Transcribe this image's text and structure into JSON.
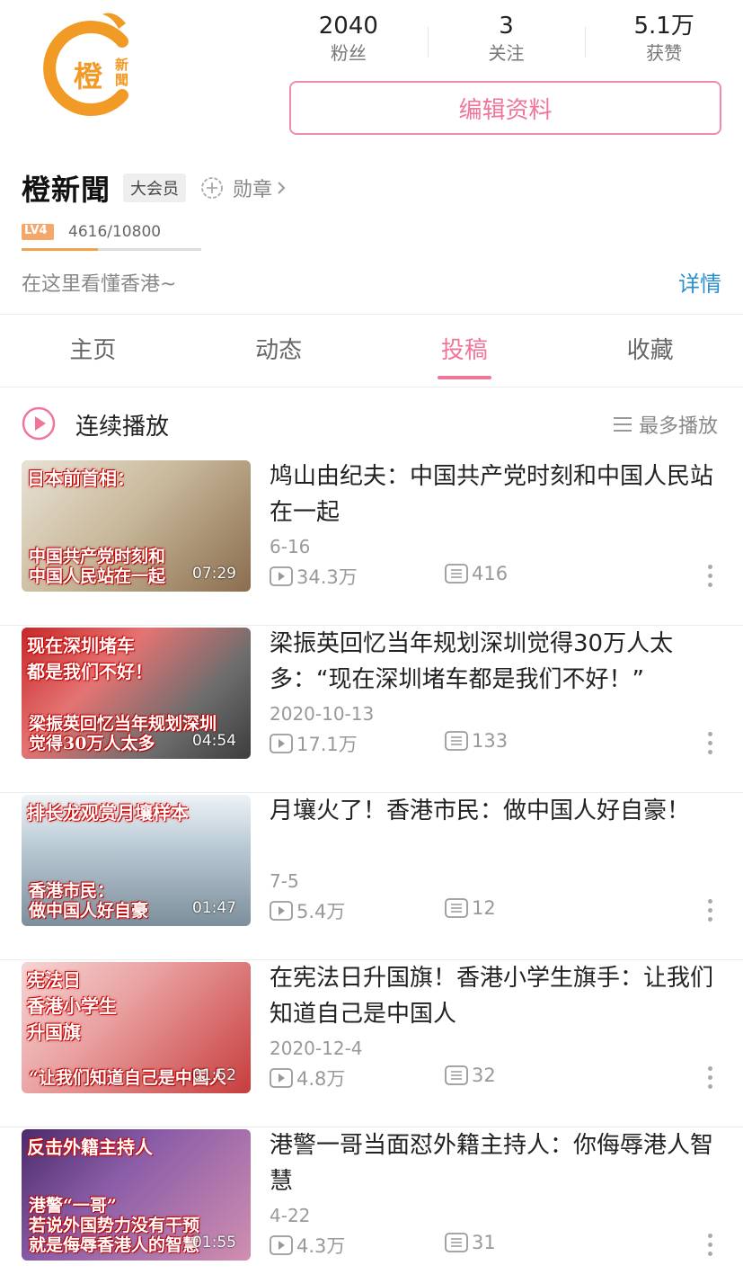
{
  "profile": {
    "logo_text": "橙",
    "logo_sub": "新聞",
    "name": "橙新聞",
    "vip_badge": "大会员",
    "medal_label": "勋章",
    "level_badge": "LV4",
    "exp_text": "4616/10800",
    "exp_fraction": 0.427,
    "signature": "在这里看懂香港~",
    "detail_label": "详情",
    "edit_button": "编辑资料"
  },
  "stats": [
    {
      "value": "2040",
      "label": "粉丝"
    },
    {
      "value": "3",
      "label": "关注"
    },
    {
      "value": "5.1万",
      "label": "获赞"
    }
  ],
  "tabs": [
    {
      "label": "主页",
      "active": false
    },
    {
      "label": "动态",
      "active": false
    },
    {
      "label": "投稿",
      "active": true
    },
    {
      "label": "收藏",
      "active": false
    }
  ],
  "play_bar": {
    "continuous_label": "连续播放",
    "sort_label": "最多播放"
  },
  "colors": {
    "accent": "#f07698",
    "link": "#2b8fcb",
    "logo_orange": "#f29a26"
  },
  "videos": [
    {
      "title": "鸠山由纪夫：中国共产党时刻和中国人民站在一起",
      "date": "6-16",
      "plays": "34.3万",
      "comments": "416",
      "duration": "07:29",
      "thumb_top": "日本前首相：",
      "thumb_bottom": "中国共产党时刻和\n中国人民站在一起"
    },
    {
      "title": "梁振英回忆当年规划深圳觉得30万人太多：“现在深圳堵车都是我们不好！”",
      "date": "2020-10-13",
      "plays": "17.1万",
      "comments": "133",
      "duration": "04:54",
      "thumb_top": "现在深圳堵车\n都是我们不好！",
      "thumb_bottom": "梁振英回忆当年规划深圳\n觉得30万人太多"
    },
    {
      "title": "月壤火了！香港市民：做中国人好自豪！",
      "date": "7-5",
      "plays": "5.4万",
      "comments": "12",
      "duration": "01:47",
      "thumb_top": "排长龙观赏月壤样本",
      "thumb_bottom": "香港市民：\n做中国人好自豪"
    },
    {
      "title": "在宪法日升国旗！香港小学生旗手：让我们知道自己是中国人",
      "date": "2020-12-4",
      "plays": "4.8万",
      "comments": "32",
      "duration": "01:52",
      "thumb_top": "宪法日\n香港小学生\n升国旗",
      "thumb_bottom": "“让我们知道自己是中国人"
    },
    {
      "title": "港警一哥当面怼外籍主持人：你侮辱港人智慧",
      "date": "4-22",
      "plays": "4.3万",
      "comments": "31",
      "duration": "01:55",
      "thumb_top": "反击外籍主持人",
      "thumb_bottom": "港警“一哥”\n若说外国势力没有干预\n就是侮辱香港人的智慧"
    }
  ]
}
